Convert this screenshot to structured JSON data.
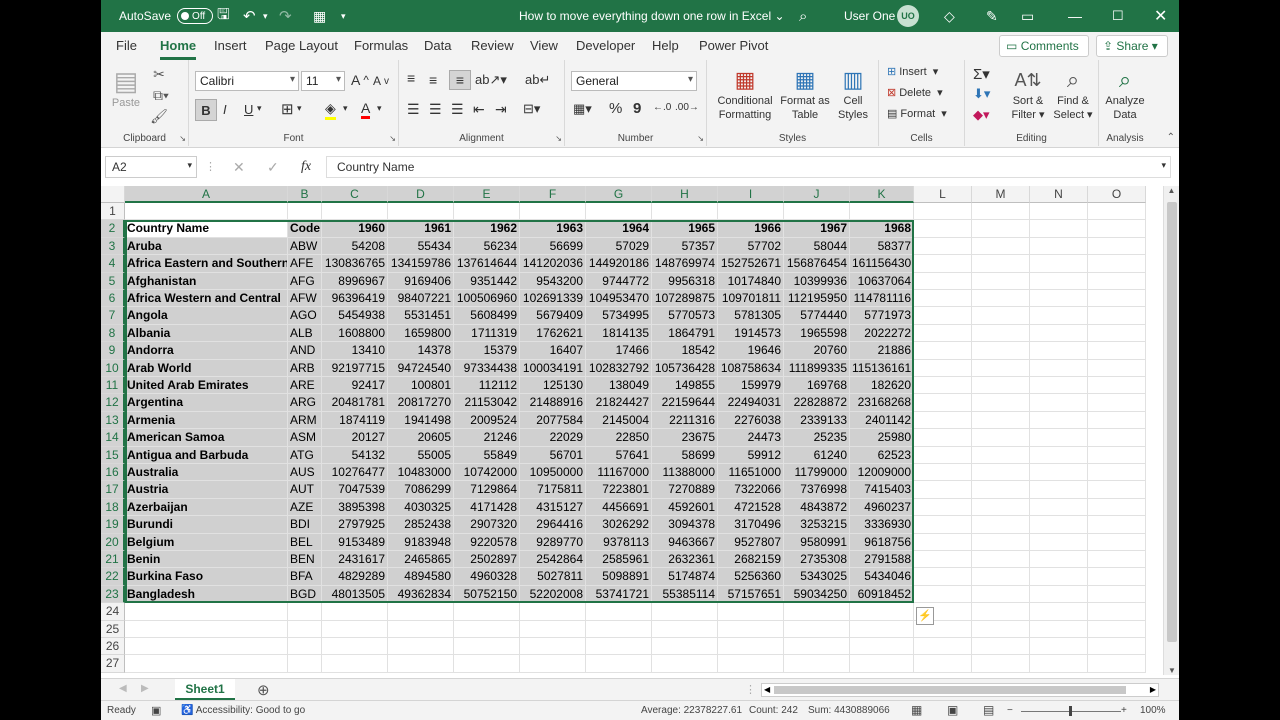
{
  "title": {
    "autosave": "AutoSave",
    "toggle": "Off",
    "doc": "How to move everything down one row in Excel",
    "user": "User One",
    "initials": "UO"
  },
  "menu": {
    "tabs": [
      "File",
      "Home",
      "Insert",
      "Page Layout",
      "Formulas",
      "Data",
      "Review",
      "View",
      "Developer",
      "Help",
      "Power Pivot"
    ],
    "comments": "Comments",
    "share": "Share"
  },
  "ribbon": {
    "clipboard": {
      "paste": "Paste",
      "label": "Clipboard"
    },
    "font": {
      "name": "Calibri",
      "size": "11",
      "label": "Font",
      "bold": "B",
      "italic": "I",
      "underline": "U",
      "grow": "A",
      "shrink": "A"
    },
    "alignment": {
      "label": "Alignment"
    },
    "number": {
      "format": "General",
      "label": "Number",
      "percent": "%",
      "comma": "9"
    },
    "styles": {
      "cond1": "Conditional",
      "cond2": "Formatting",
      "fmt1": "Format as",
      "fmt2": "Table",
      "cell1": "Cell",
      "cell2": "Styles",
      "label": "Styles"
    },
    "cells": {
      "insert": "Insert",
      "delete": "Delete",
      "format": "Format",
      "label": "Cells"
    },
    "editing": {
      "sort1": "Sort &",
      "sort2": "Filter",
      "find1": "Find &",
      "find2": "Select",
      "label": "Editing"
    },
    "analysis": {
      "a1": "Analyze",
      "a2": "Data",
      "label": "Analysis"
    }
  },
  "formula": {
    "namebox": "A2",
    "content": "Country Name",
    "fx": "fx"
  },
  "columns": [
    "A",
    "B",
    "C",
    "D",
    "E",
    "F",
    "G",
    "H",
    "I",
    "J",
    "K",
    "L",
    "M",
    "N",
    "O"
  ],
  "header": [
    "Country Name",
    "Code",
    "1960",
    "1961",
    "1962",
    "1963",
    "1964",
    "1965",
    "1966",
    "1967",
    "1968"
  ],
  "rows": [
    [
      "Aruba",
      "ABW",
      "54208",
      "55434",
      "56234",
      "56699",
      "57029",
      "57357",
      "57702",
      "58044",
      "58377"
    ],
    [
      "Africa Eastern and Southern",
      "AFE",
      "130836765",
      "134159786",
      "137614644",
      "141202036",
      "144920186",
      "148769974",
      "152752671",
      "156876454",
      "161156430"
    ],
    [
      "Afghanistan",
      "AFG",
      "8996967",
      "9169406",
      "9351442",
      "9543200",
      "9744772",
      "9956318",
      "10174840",
      "10399936",
      "10637064"
    ],
    [
      "Africa Western and Central",
      "AFW",
      "96396419",
      "98407221",
      "100506960",
      "102691339",
      "104953470",
      "107289875",
      "109701811",
      "112195950",
      "114781116"
    ],
    [
      "Angola",
      "AGO",
      "5454938",
      "5531451",
      "5608499",
      "5679409",
      "5734995",
      "5770573",
      "5781305",
      "5774440",
      "5771973"
    ],
    [
      "Albania",
      "ALB",
      "1608800",
      "1659800",
      "1711319",
      "1762621",
      "1814135",
      "1864791",
      "1914573",
      "1965598",
      "2022272"
    ],
    [
      "Andorra",
      "AND",
      "13410",
      "14378",
      "15379",
      "16407",
      "17466",
      "18542",
      "19646",
      "20760",
      "21886"
    ],
    [
      "Arab World",
      "ARB",
      "92197715",
      "94724540",
      "97334438",
      "100034191",
      "102832792",
      "105736428",
      "108758634",
      "111899335",
      "115136161"
    ],
    [
      "United Arab Emirates",
      "ARE",
      "92417",
      "100801",
      "112112",
      "125130",
      "138049",
      "149855",
      "159979",
      "169768",
      "182620"
    ],
    [
      "Argentina",
      "ARG",
      "20481781",
      "20817270",
      "21153042",
      "21488916",
      "21824427",
      "22159644",
      "22494031",
      "22828872",
      "23168268"
    ],
    [
      "Armenia",
      "ARM",
      "1874119",
      "1941498",
      "2009524",
      "2077584",
      "2145004",
      "2211316",
      "2276038",
      "2339133",
      "2401142"
    ],
    [
      "American Samoa",
      "ASM",
      "20127",
      "20605",
      "21246",
      "22029",
      "22850",
      "23675",
      "24473",
      "25235",
      "25980"
    ],
    [
      "Antigua and Barbuda",
      "ATG",
      "54132",
      "55005",
      "55849",
      "56701",
      "57641",
      "58699",
      "59912",
      "61240",
      "62523"
    ],
    [
      "Australia",
      "AUS",
      "10276477",
      "10483000",
      "10742000",
      "10950000",
      "11167000",
      "11388000",
      "11651000",
      "11799000",
      "12009000"
    ],
    [
      "Austria",
      "AUT",
      "7047539",
      "7086299",
      "7129864",
      "7175811",
      "7223801",
      "7270889",
      "7322066",
      "7376998",
      "7415403"
    ],
    [
      "Azerbaijan",
      "AZE",
      "3895398",
      "4030325",
      "4171428",
      "4315127",
      "4456691",
      "4592601",
      "4721528",
      "4843872",
      "4960237"
    ],
    [
      "Burundi",
      "BDI",
      "2797925",
      "2852438",
      "2907320",
      "2964416",
      "3026292",
      "3094378",
      "3170496",
      "3253215",
      "3336930"
    ],
    [
      "Belgium",
      "BEL",
      "9153489",
      "9183948",
      "9220578",
      "9289770",
      "9378113",
      "9463667",
      "9527807",
      "9580991",
      "9618756"
    ],
    [
      "Benin",
      "BEN",
      "2431617",
      "2465865",
      "2502897",
      "2542864",
      "2585961",
      "2632361",
      "2682159",
      "2735308",
      "2791588"
    ],
    [
      "Burkina Faso",
      "BFA",
      "4829289",
      "4894580",
      "4960328",
      "5027811",
      "5098891",
      "5174874",
      "5256360",
      "5343025",
      "5434046"
    ],
    [
      "Bangladesh",
      "BGD",
      "48013505",
      "49362834",
      "50752150",
      "52202008",
      "53741721",
      "55385114",
      "57157651",
      "59034250",
      "60918452"
    ]
  ],
  "extra_rows": [
    "24",
    "25",
    "26",
    "27"
  ],
  "sheet": {
    "name": "Sheet1"
  },
  "status": {
    "ready": "Ready",
    "accessibility": "Accessibility: Good to go",
    "average": "Average: 22378227.61",
    "count": "Count: 242",
    "sum": "Sum: 4430889066",
    "zoom": "100%"
  }
}
